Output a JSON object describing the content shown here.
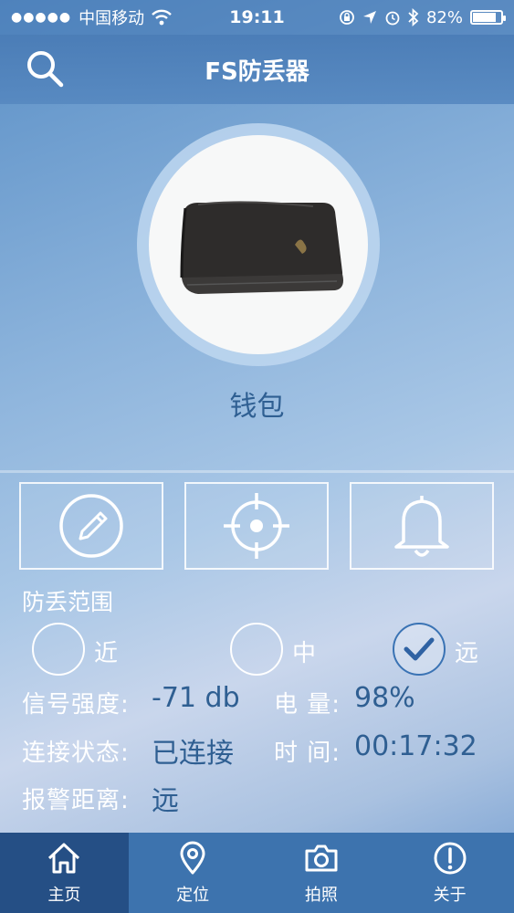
{
  "status_bar": {
    "carrier": "中国移动",
    "time": "19:11",
    "battery": "82%",
    "battery_level": 0.82
  },
  "nav": {
    "title": "FS防丢器"
  },
  "item": {
    "name": "钱包"
  },
  "range": {
    "heading": "防丢范围",
    "options": [
      "近",
      "中",
      "远"
    ],
    "selected": "远"
  },
  "info": {
    "signal_label": "信号强度:",
    "signal_value": "-71 db",
    "battery_label": "电 量:",
    "battery_value": "98%",
    "connection_label": "连接状态:",
    "connection_value": "已连接",
    "time_label": "时 间:",
    "time_value": "00:17:32",
    "alarm_label": "报警距离:",
    "alarm_value": "远"
  },
  "tabs": [
    {
      "label": "主页",
      "icon": "home-icon",
      "active": true
    },
    {
      "label": "定位",
      "icon": "location-pin-icon",
      "active": false
    },
    {
      "label": "拍照",
      "icon": "camera-icon",
      "active": false
    },
    {
      "label": "关于",
      "icon": "info-icon",
      "active": false
    }
  ],
  "colors": {
    "accent": "#2f5f92",
    "tab_bar": "#3d73ae",
    "tab_active": "#254f85"
  }
}
